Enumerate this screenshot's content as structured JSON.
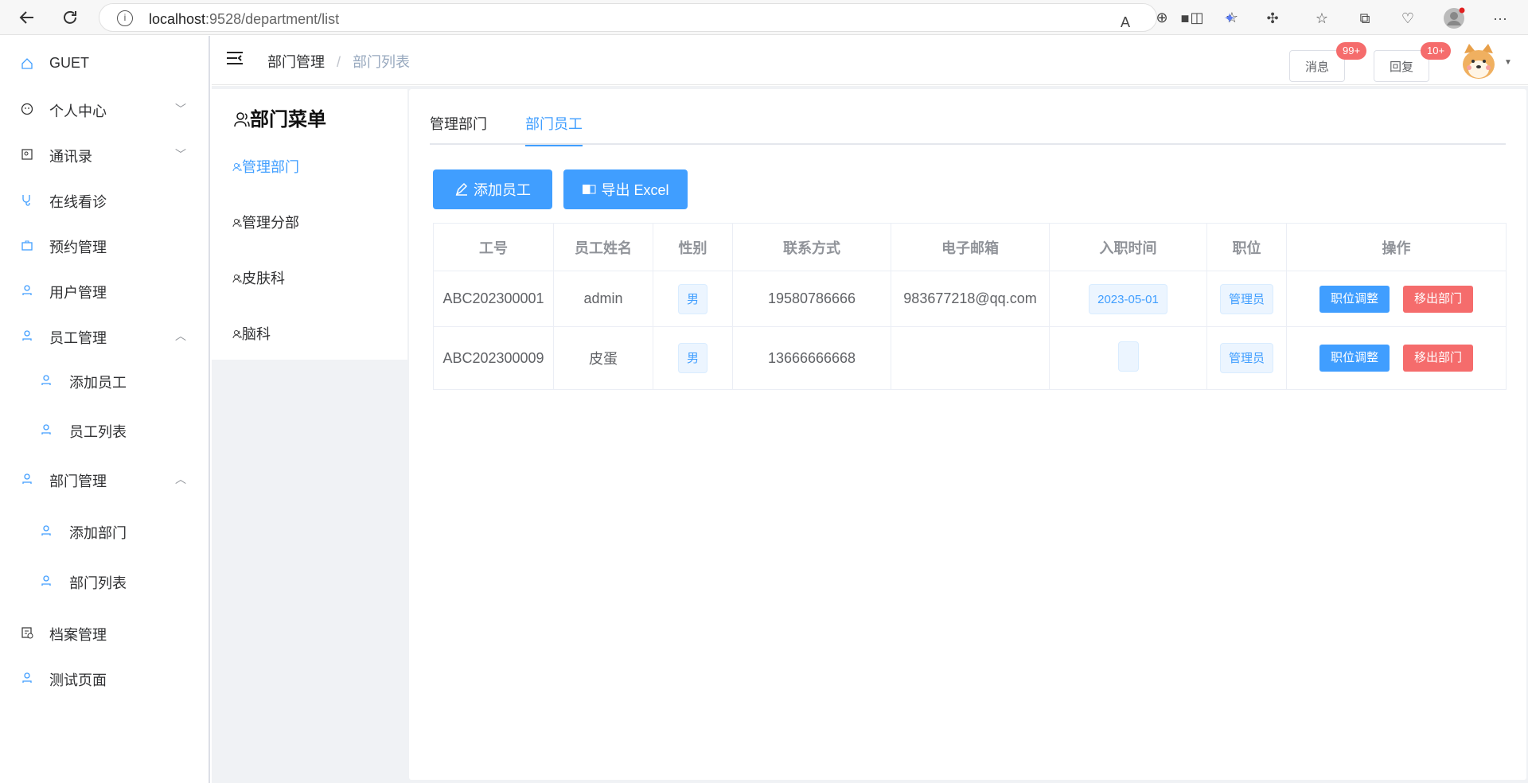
{
  "browser": {
    "url_host": "localhost",
    "url_path": ":9528/department/list"
  },
  "sidebar": {
    "items": [
      {
        "label": "GUET",
        "icon": "home-icon",
        "chevron": ""
      },
      {
        "label": "个人中心",
        "icon": "smile-icon",
        "chevron": "down"
      },
      {
        "label": "通讯录",
        "icon": "contacts-icon",
        "chevron": "down"
      },
      {
        "label": "在线看诊",
        "icon": "stethoscope-icon",
        "chevron": ""
      },
      {
        "label": "预约管理",
        "icon": "briefcase-icon",
        "chevron": ""
      },
      {
        "label": "用户管理",
        "icon": "user-icon",
        "chevron": ""
      },
      {
        "label": "员工管理",
        "icon": "user-icon",
        "chevron": "up"
      },
      {
        "label": "添加员工",
        "icon": "user-icon",
        "chevron": ""
      },
      {
        "label": "员工列表",
        "icon": "user-icon",
        "chevron": ""
      },
      {
        "label": "部门管理",
        "icon": "user-icon",
        "chevron": "up"
      },
      {
        "label": "添加部门",
        "icon": "user-icon",
        "chevron": ""
      },
      {
        "label": "部门列表",
        "icon": "user-icon",
        "chevron": ""
      },
      {
        "label": "档案管理",
        "icon": "document-check-icon",
        "chevron": ""
      },
      {
        "label": "测试页面",
        "icon": "user-icon",
        "chevron": ""
      }
    ]
  },
  "header": {
    "breadcrumb": [
      "部门管理",
      "部门列表"
    ],
    "separator": "/",
    "message_label": "消息",
    "message_badge": "99+",
    "reply_label": "回复",
    "reply_badge": "10+"
  },
  "dept_menu": {
    "title": "部门菜单",
    "items": [
      "管理部门",
      "管理分部",
      "皮肤科",
      "脑科"
    ],
    "active_index": 0
  },
  "main": {
    "tabs": [
      "管理部门",
      "部门员工"
    ],
    "active_tab": 1,
    "add_button": "添加员工",
    "export_button": "导出 Excel",
    "columns": [
      "工号",
      "员工姓名",
      "性别",
      "联系方式",
      "电子邮箱",
      "入职时间",
      "职位",
      "操作"
    ],
    "rows": [
      {
        "id": "ABC202300001",
        "name": "admin",
        "gender": "男",
        "phone": "19580786666",
        "email": "983677218@qq.com",
        "join_date": "2023-05-01",
        "position": "管理员",
        "action_adjust": "职位调整",
        "action_remove": "移出部门"
      },
      {
        "id": "ABC202300009",
        "name": "皮蛋",
        "gender": "男",
        "phone": "13666666668",
        "email": "",
        "join_date": "",
        "position": "管理员",
        "action_adjust": "职位调整",
        "action_remove": "移出部门"
      }
    ]
  },
  "colors": {
    "primary": "#409eff",
    "danger": "#f56c6c",
    "text": "#303133"
  }
}
